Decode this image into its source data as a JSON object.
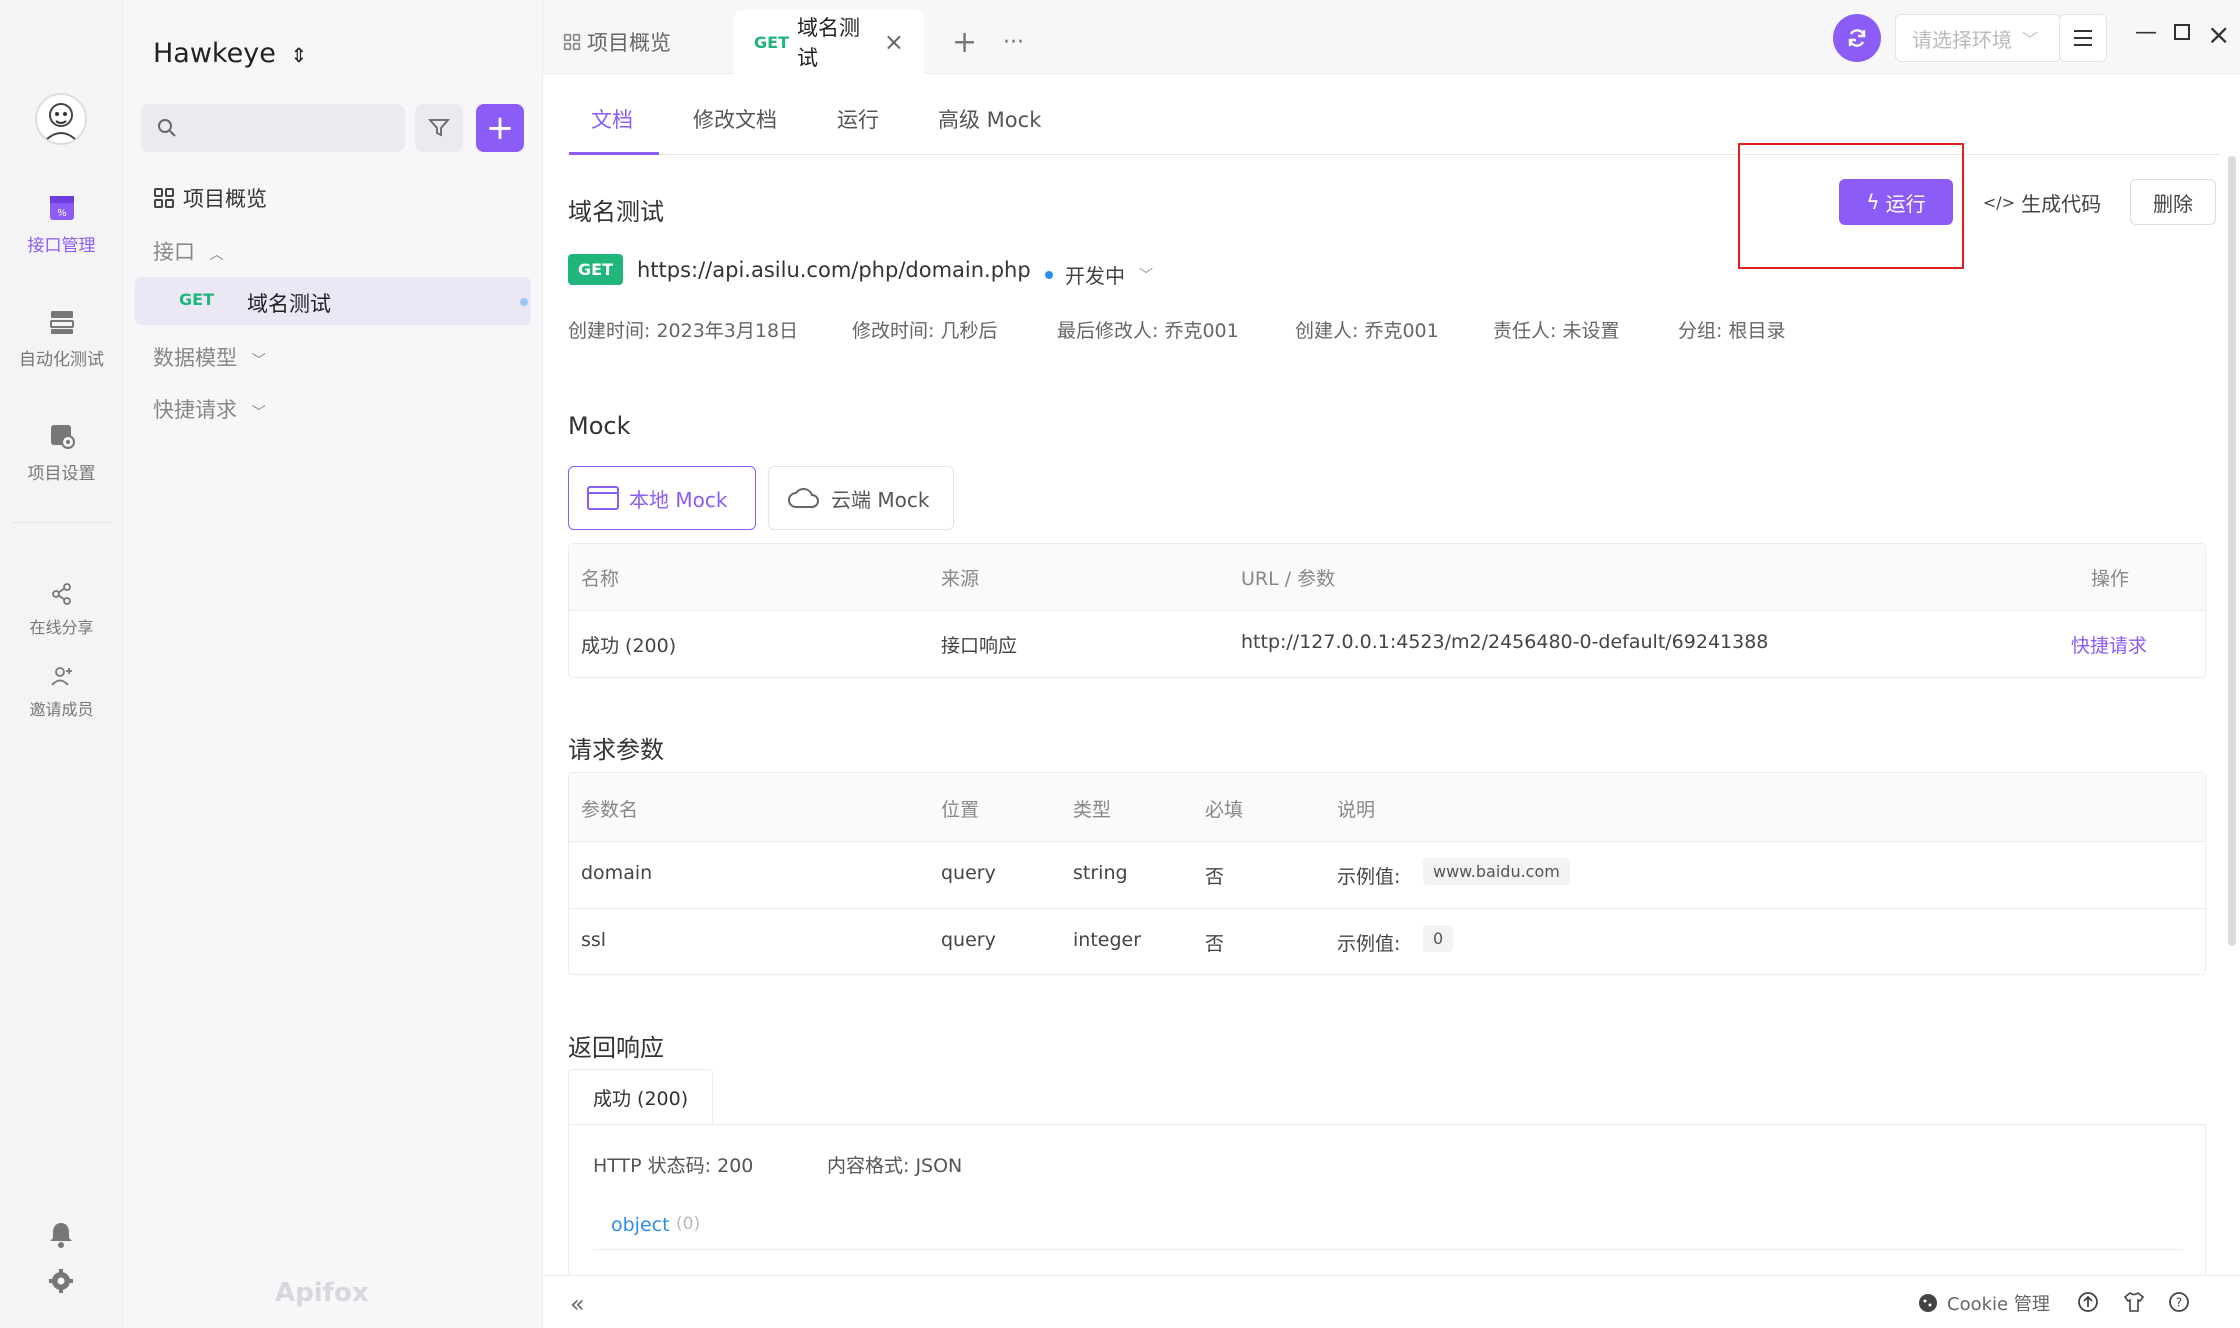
{
  "app": {
    "project_name": "Hawkeye",
    "watermark": "Apifox"
  },
  "rail": {
    "items": [
      {
        "label": "接口管理",
        "active": true
      },
      {
        "label": "自动化测试"
      },
      {
        "label": "项目设置"
      },
      {
        "label": "在线分享"
      },
      {
        "label": "邀请成员"
      }
    ]
  },
  "sidebar": {
    "overview": "项目概览",
    "api_group": "接口",
    "active_item": {
      "method": "GET",
      "name": "域名测试"
    },
    "data_model": "数据模型",
    "quick_request": "快捷请求"
  },
  "tabs": {
    "overview": "项目概览",
    "active": {
      "method": "GET",
      "label": "域名测试"
    },
    "add": "+",
    "more": "···"
  },
  "topbar": {
    "env_placeholder": "请选择环境"
  },
  "subtabs": [
    "文档",
    "修改文档",
    "运行",
    "高级 Mock"
  ],
  "api": {
    "title": "域名测试",
    "method": "GET",
    "url": "https://api.asilu.com/php/domain.php",
    "status": "开发中",
    "run_label": "运行",
    "gen_code_label": "生成代码",
    "delete_label": "删除",
    "meta": {
      "created": "创建时间: 2023年3月18日",
      "modified": "修改时间: 几秒后",
      "last_modifier": "最后修改人: 乔克001",
      "creator": "创建人: 乔克001",
      "owner": "责任人: 未设置",
      "group": "分组: 根目录"
    }
  },
  "mock": {
    "heading": "Mock",
    "local_tab": "本地 Mock",
    "cloud_tab": "云端 Mock",
    "columns": [
      "名称",
      "来源",
      "URL / 参数",
      "操作"
    ],
    "row": {
      "name": "成功 (200)",
      "source": "接口响应",
      "url": "http://127.0.0.1:4523/m2/2456480-0-default/69241388",
      "action": "快捷请求"
    }
  },
  "params": {
    "heading": "请求参数",
    "columns": [
      "参数名",
      "位置",
      "类型",
      "必填",
      "说明"
    ],
    "example_label": "示例值:",
    "rows": [
      {
        "name": "domain",
        "location": "query",
        "type": "string",
        "required": "否",
        "example": "www.baidu.com"
      },
      {
        "name": "ssl",
        "location": "query",
        "type": "integer",
        "required": "否",
        "example": "0"
      }
    ]
  },
  "response": {
    "heading": "返回响应",
    "tab": "成功 (200)",
    "http_status": "HTTP 状态码: 200",
    "content_type": "内容格式: JSON",
    "schema_type": "object",
    "schema_count": "(0)"
  },
  "footer": {
    "cookie": "Cookie 管理"
  },
  "colors": {
    "accent": "#8b5cf6",
    "get": "#1fb57b",
    "highlight_box": "#e02020"
  }
}
